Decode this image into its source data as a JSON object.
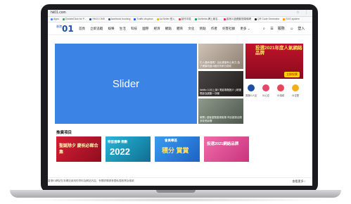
{
  "browser": {
    "url": "hk01.com",
    "bookmarks": [
      {
        "label": "Apps",
        "color": "#4285f4"
      },
      {
        "label": "DoubleClick for P...",
        "color": "#34a853"
      },
      {
        "label": "HK01 CMS",
        "color": "#1e4fa3"
      },
      {
        "label": "facebook booking",
        "color": "#3b5998"
      },
      {
        "label": "Traffic dropbox",
        "color": "#0061ff"
      },
      {
        "label": "Ad Seller 登入",
        "color": "#f4b400"
      },
      {
        "label": "創作中區",
        "color": "#db4437"
      },
      {
        "label": "Ourfields 網上報名...",
        "color": "#0f9d58"
      },
      {
        "label": "香港01遊戲動態頭條網",
        "color": "#e91e63"
      },
      {
        "label": "QR Code Generator",
        "color": "#222222"
      },
      {
        "label": "SXG system",
        "color": "#ff9800"
      }
    ]
  },
  "site": {
    "logo_small": "香港",
    "logo_number": "01",
    "nav": [
      "首頁",
      "立即追蹤",
      "娛樂",
      "生活",
      "科技",
      "國際",
      "經濟",
      "觀點",
      "體育",
      "文化",
      "熱點",
      "作者",
      "好客社群",
      "更多 ⌄"
    ],
    "service_label": "服務",
    "login_label": "登入"
  },
  "slider": {
    "label": "Slider"
  },
  "thumbs": [
    {
      "caption": "牛人遇命運嗎？全民健康有心有力 為了健康改變 6個月作即日成效",
      "bg": "#b9ab9c"
    },
    {
      "caption": "Netflix 10月上架!! 電影專題推介 | 精選電影及劇集一次睇",
      "bg": "#3a3535"
    },
    {
      "caption": "新聞 | 遊客遊覽香港街頭 市民被邀合照 多區受影響",
      "bg": "#6f7d6e"
    }
  ],
  "ad": {
    "title": "投選2021年度人氣網絡品牌",
    "tag": "立即投票"
  },
  "quicklinks": [
    {
      "label": "香港01人氣",
      "color": "#1e4fa3"
    },
    {
      "label": "01心意",
      "color": "#e24a6b"
    },
    {
      "label": "01領域",
      "color": "#e8465a"
    },
    {
      "label": "01空間",
      "color": "#f2b01e"
    }
  ],
  "section": {
    "title": "推廣項目"
  },
  "cards": [
    {
      "title": "聖誕除夕 慶祝必睇合集",
      "bg": "#c8102e"
    },
    {
      "title": "2022",
      "sub": "特首選舉 倒數",
      "bg": "#1aa7c9"
    },
    {
      "title": "積分 賞賞",
      "sub": "會員專區",
      "bg": "#2f8fe0"
    },
    {
      "title": "投選2021網絡品牌",
      "bg": "#e8539a"
    }
  ],
  "footer": {
    "notice": "香港01網站在本網站使用的資料及網站內容，有關詳情請參閱私隱政策及條款",
    "more": "查看更多 ›"
  }
}
